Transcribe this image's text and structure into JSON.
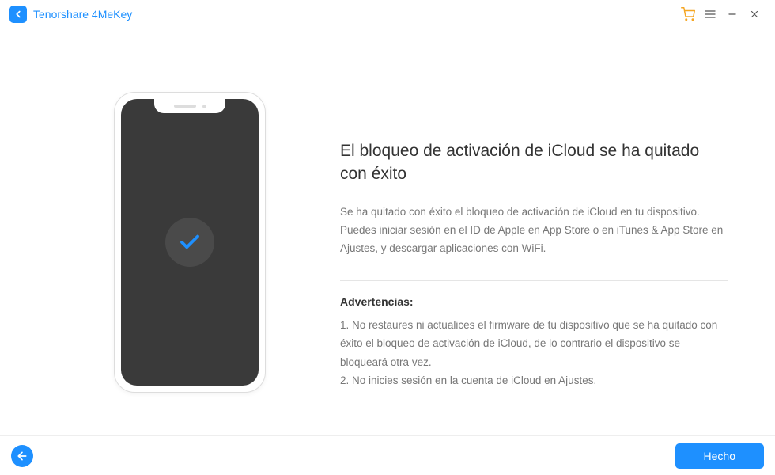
{
  "app": {
    "title": "Tenorshare 4MeKey"
  },
  "main": {
    "heading": "El bloqueo de activación de iCloud se ha quitado con éxito",
    "description": "Se ha quitado con éxito el bloqueo de activación de iCloud en tu dispositivo. Puedes iniciar sesión en el ID de Apple en App Store o en iTunes & App Store en Ajustes, y descargar aplicaciones con WiFi.",
    "warnings_title": "Advertencias:",
    "warnings": [
      "1. No restaures ni actualices el firmware de tu dispositivo que se ha quitado con éxito el bloqueo de activación de iCloud, de lo contrario el dispositivo se bloqueará otra vez.",
      "2. No inicies sesión en la cuenta de iCloud en Ajustes."
    ]
  },
  "footer": {
    "done_label": "Hecho"
  }
}
